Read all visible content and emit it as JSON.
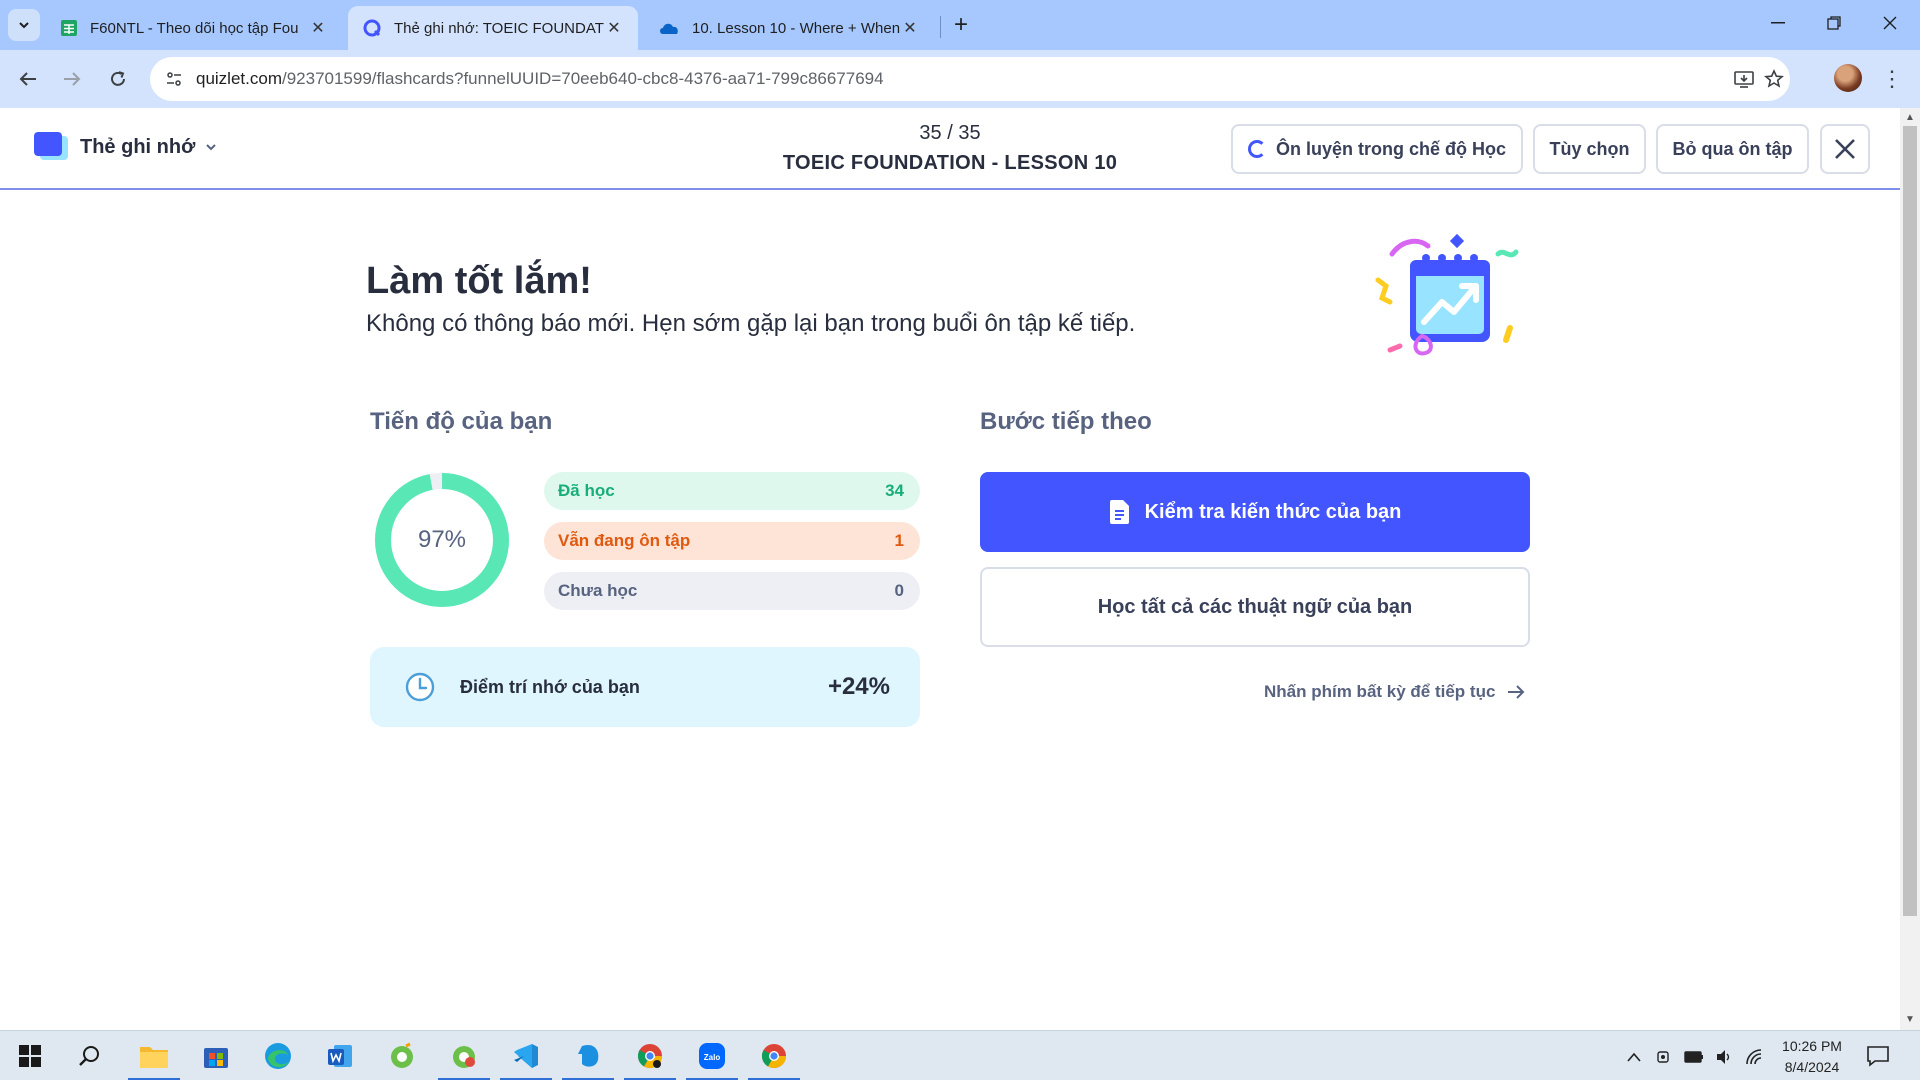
{
  "browser": {
    "tabs": [
      {
        "title": "F60NTL - Theo dõi học tập Fou",
        "icon": "sheets-icon",
        "active": false
      },
      {
        "title": "Thẻ ghi nhớ: TOEIC FOUNDATIC",
        "icon": "quizlet-icon",
        "active": true
      },
      {
        "title": "10. Lesson 10 - Where + When",
        "icon": "onedrive-icon",
        "active": false
      }
    ],
    "new_tab_label": "+",
    "url_host": "quizlet.com",
    "url_path": "/923701599/flashcards?funnelUUID=70eeb640-cbc8-4376-aa71-799c86677694"
  },
  "header": {
    "mode_label": "Thẻ ghi nhớ",
    "progress": "35 / 35",
    "set_title": "TOEIC FOUNDATION - LESSON 10",
    "study_mode_button": "Ôn luyện trong chế độ Học",
    "options_button": "Tùy chọn",
    "skip_review_button": "Bỏ qua ôn tập"
  },
  "main": {
    "headline": "Làm tốt lắm!",
    "subline": "Không có thông báo mới. Hẹn sớm gặp lại bạn trong buổi ôn tập kế tiếp.",
    "progress_section": {
      "title": "Tiến độ của bạn",
      "percent_label": "97%",
      "percent_value": 0.97,
      "stats": [
        {
          "label": "Đã học",
          "value": "34"
        },
        {
          "label": "Vẫn đang ôn tập",
          "value": "1"
        },
        {
          "label": "Chưa học",
          "value": "0"
        }
      ],
      "memory_label": "Điểm trí nhớ của bạn",
      "memory_value": "+24%"
    },
    "next_steps": {
      "title": "Bước tiếp theo",
      "primary_button": "Kiểm tra kiến thức của bạn",
      "secondary_button": "Học tất cả các thuật ngữ của bạn",
      "continue_hint": "Nhấn phím bất kỳ để tiếp tục"
    }
  },
  "colors": {
    "brand": "#4255ff",
    "learned": "#18ae79",
    "reviewing": "#e0590f",
    "donut": "#59e8b5"
  },
  "taskbar": {
    "time": "10:26 PM",
    "date": "8/4/2024"
  }
}
